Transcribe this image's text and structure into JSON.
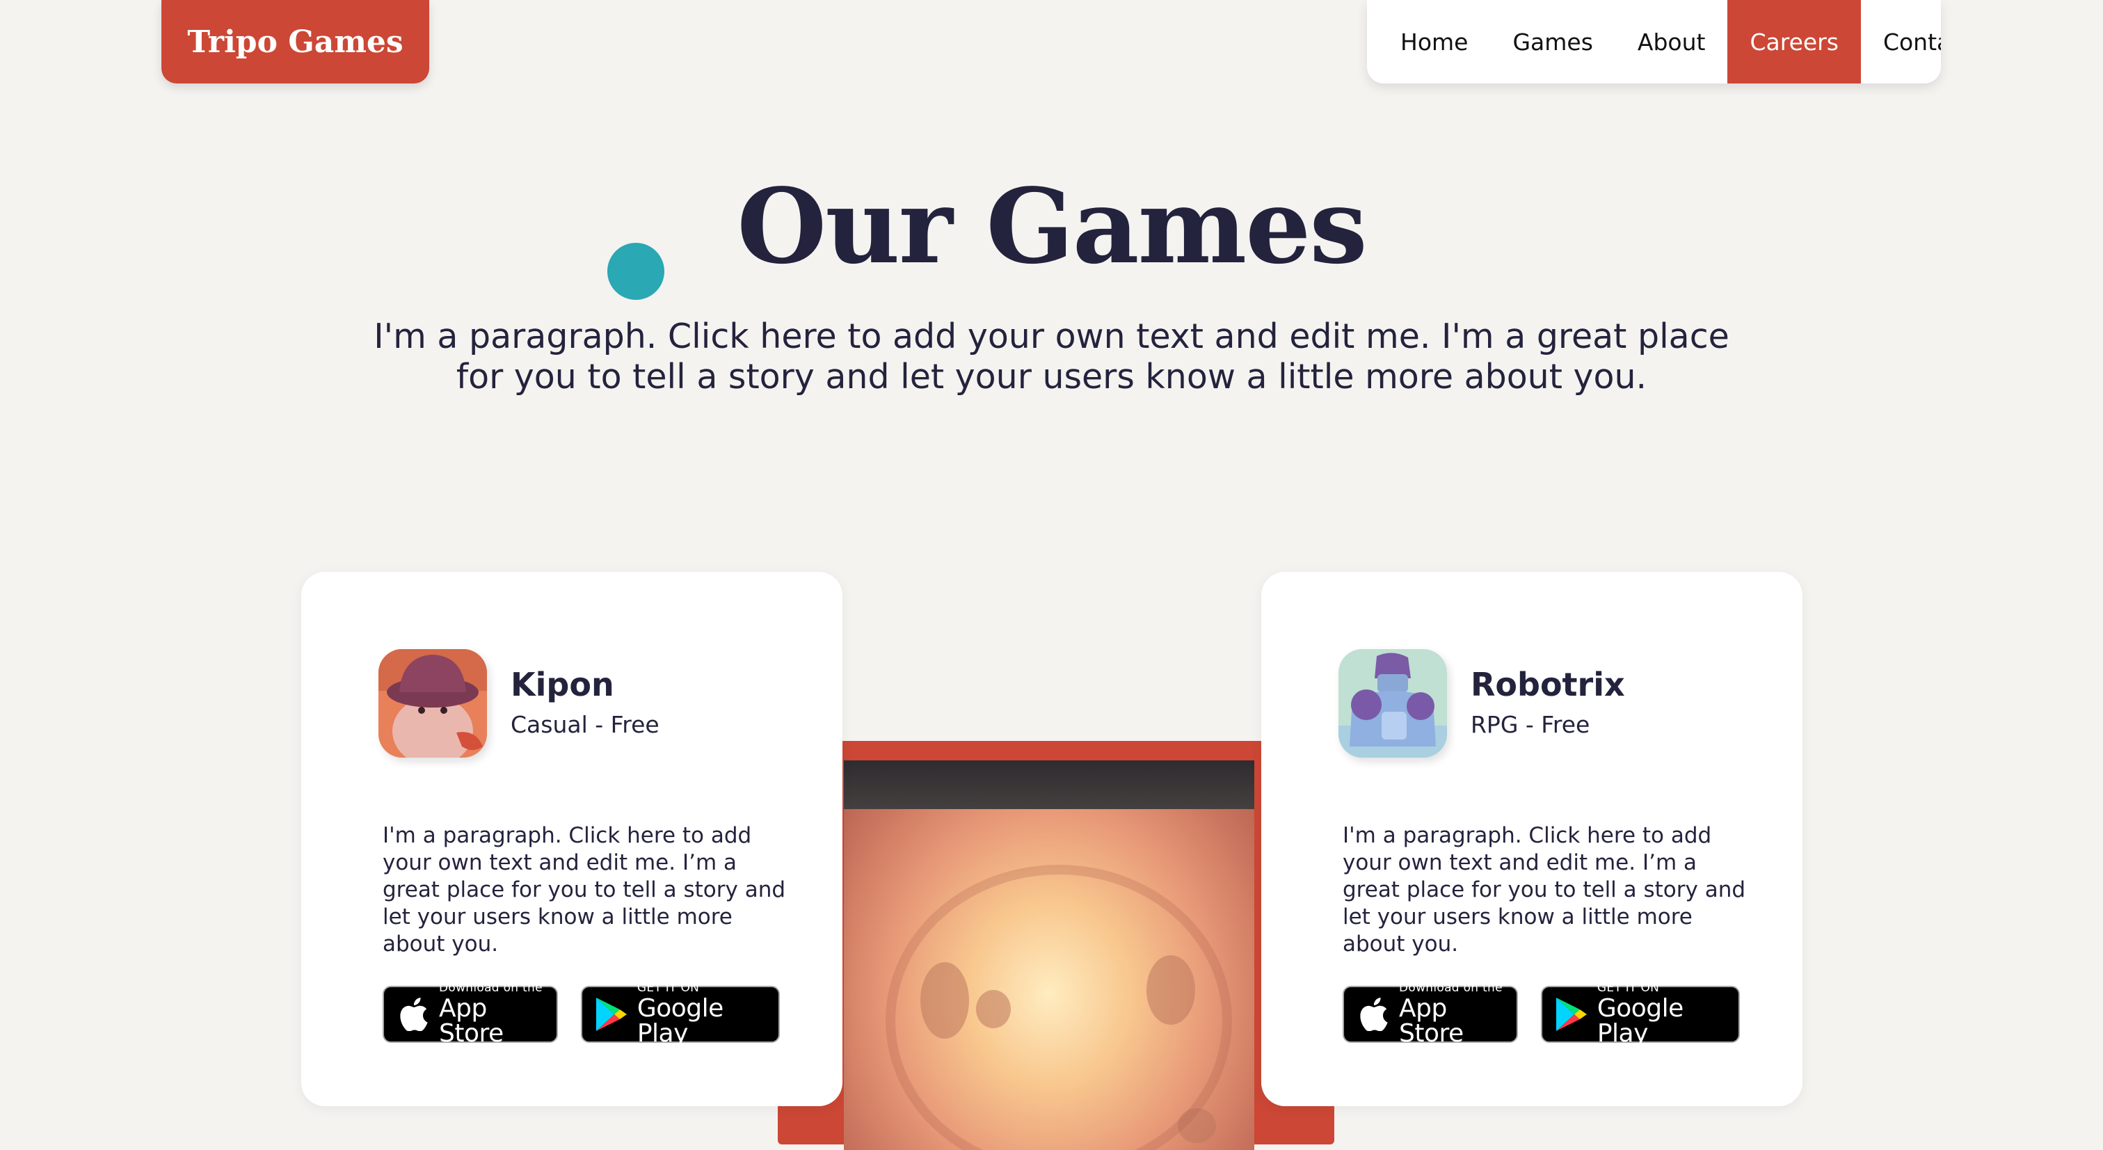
{
  "header": {
    "logo_text": "Tripo Games",
    "nav": [
      {
        "label": "Home"
      },
      {
        "label": "Games"
      },
      {
        "label": "About"
      },
      {
        "label": "Careers",
        "active": true
      },
      {
        "label": "Contact"
      }
    ]
  },
  "hero": {
    "title": "Our Games",
    "paragraph": "I'm a paragraph. Click here to add your own text and edit me. I'm a great place for you to tell a story and let your users know a little more about you."
  },
  "games": [
    {
      "title": "Kipon",
      "subtitle": "Casual - Free",
      "description": "I'm a paragraph. Click here to add your own text and edit me. I’m a great place for you to tell a story and let your users know a little more about you.",
      "icon": "kipon-app-icon"
    },
    {
      "title": "Robotrix",
      "subtitle": "RPG - Free",
      "description": "I'm a paragraph. Click here to add your own text and edit me. I’m a great place for you to tell a story and let your users know a little more about you.",
      "icon": "robotrix-app-icon"
    }
  ],
  "badges": {
    "apple_small": "Download on the",
    "apple_big": "App Store",
    "google_small": "GET IT ON",
    "google_big": "Google Play"
  },
  "colors": {
    "accent": "#cc4735",
    "background": "#f4f3f0",
    "text": "#24233d",
    "dot": "#2aa8b3"
  }
}
